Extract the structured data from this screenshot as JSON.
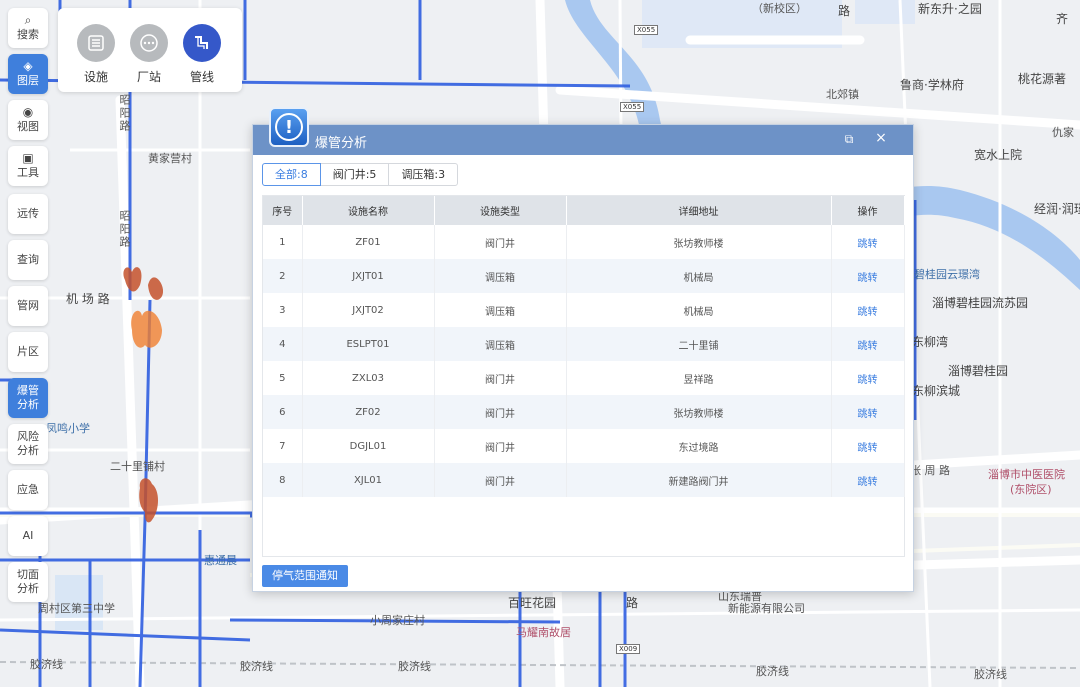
{
  "map": {
    "labels": {
      "xinfang_town": "（新校区）",
      "xinfang_road": "新东升·之园",
      "qi": "齐",
      "luxun": "鲁商·学林府",
      "taohua": "桃花源著",
      "beijiao": "北郊镇",
      "qiujia": "仇家",
      "kuanshui": "宽水上院",
      "jingrun": "经润·润瑾",
      "huangjia": "黄家营村",
      "bgy_yunhuan": "碧桂园云璟湾",
      "bgy_liusu": "淄博碧桂园流苏园",
      "dongliuwan": "东柳湾",
      "zibo_bgy": "淄博碧桂园",
      "dongliu_bc": "东柳滨城",
      "jichang": "机 场 路",
      "fengming": "凤鸣小学",
      "ershili": "二十里铺村",
      "huitong": "惠通晨",
      "zhangzhou": "张 周 路",
      "hospital_1": "淄博市中医医院",
      "hospital_2": "(东院区)",
      "xiaozhou": "小周家庄村",
      "baiwang": "百旺花园",
      "malun": "马耀南故居",
      "shandong_1": "山东瑞普",
      "shandong_2": "新能源有限公司",
      "road_lu": "路",
      "road_lu2": "路",
      "school": "周村区第三中学",
      "jiaoji_1": "胶济线",
      "jiaoji_2": "胶济线",
      "jiaoji_3": "胶济线",
      "jiaoji_4": "胶济线",
      "jiaoji_5": "胶济线",
      "zhaoyang_1": "昭阳路",
      "zhaoyang_2": "昭阳路",
      "x055a": "X055",
      "x055b": "X055",
      "x009": "X009"
    }
  },
  "toolbar": {
    "items": [
      {
        "label": "搜索",
        "icon": "search-icon"
      },
      {
        "label": "图层",
        "icon": "layers-icon"
      },
      {
        "label": "视图",
        "icon": "view-icon"
      },
      {
        "label": "工具",
        "icon": "toolbox-icon"
      },
      {
        "label": "远传"
      },
      {
        "label": "查询"
      },
      {
        "label": "管网"
      },
      {
        "label": "片区"
      },
      {
        "label": "爆管分析"
      },
      {
        "label": "风险分析"
      },
      {
        "label": "应急"
      },
      {
        "label": "AI"
      },
      {
        "label": "切面分析"
      }
    ]
  },
  "layers": {
    "items": [
      {
        "label": "设施",
        "icon": "facility-icon"
      },
      {
        "label": "厂站",
        "icon": "station-icon"
      },
      {
        "label": "管线",
        "icon": "pipeline-icon"
      }
    ]
  },
  "dialog": {
    "title": "爆管分析",
    "tabs": [
      {
        "label": "全部:8"
      },
      {
        "label": "阀门井:5"
      },
      {
        "label": "调压箱:3"
      }
    ],
    "columns": [
      "序号",
      "设施名称",
      "设施类型",
      "详细地址",
      "操作"
    ],
    "rows": [
      {
        "no": "1",
        "name": "ZF01",
        "type": "阀门井",
        "address": "张坊教师楼",
        "op": "跳转"
      },
      {
        "no": "2",
        "name": "JXJT01",
        "type": "调压箱",
        "address": "机械局",
        "op": "跳转"
      },
      {
        "no": "3",
        "name": "JXJT02",
        "type": "调压箱",
        "address": "机械局",
        "op": "跳转"
      },
      {
        "no": "4",
        "name": "ESLPT01",
        "type": "调压箱",
        "address": "二十里铺",
        "op": "跳转"
      },
      {
        "no": "5",
        "name": "ZXL03",
        "type": "阀门井",
        "address": "昱祥路",
        "op": "跳转"
      },
      {
        "no": "6",
        "name": "ZF02",
        "type": "阀门井",
        "address": "张坊教师楼",
        "op": "跳转"
      },
      {
        "no": "7",
        "name": "DGJL01",
        "type": "阀门井",
        "address": "东过境路",
        "op": "跳转"
      },
      {
        "no": "8",
        "name": "XJL01",
        "type": "阀门井",
        "address": "新建路阀门井",
        "op": "跳转"
      }
    ],
    "notify_label": "停气范围通知"
  },
  "colors": {
    "accent": "#3f7fdc",
    "pipeline": "#2f5ee0",
    "river": "#a9c8f0",
    "dialog_header": "#6d92c7"
  }
}
